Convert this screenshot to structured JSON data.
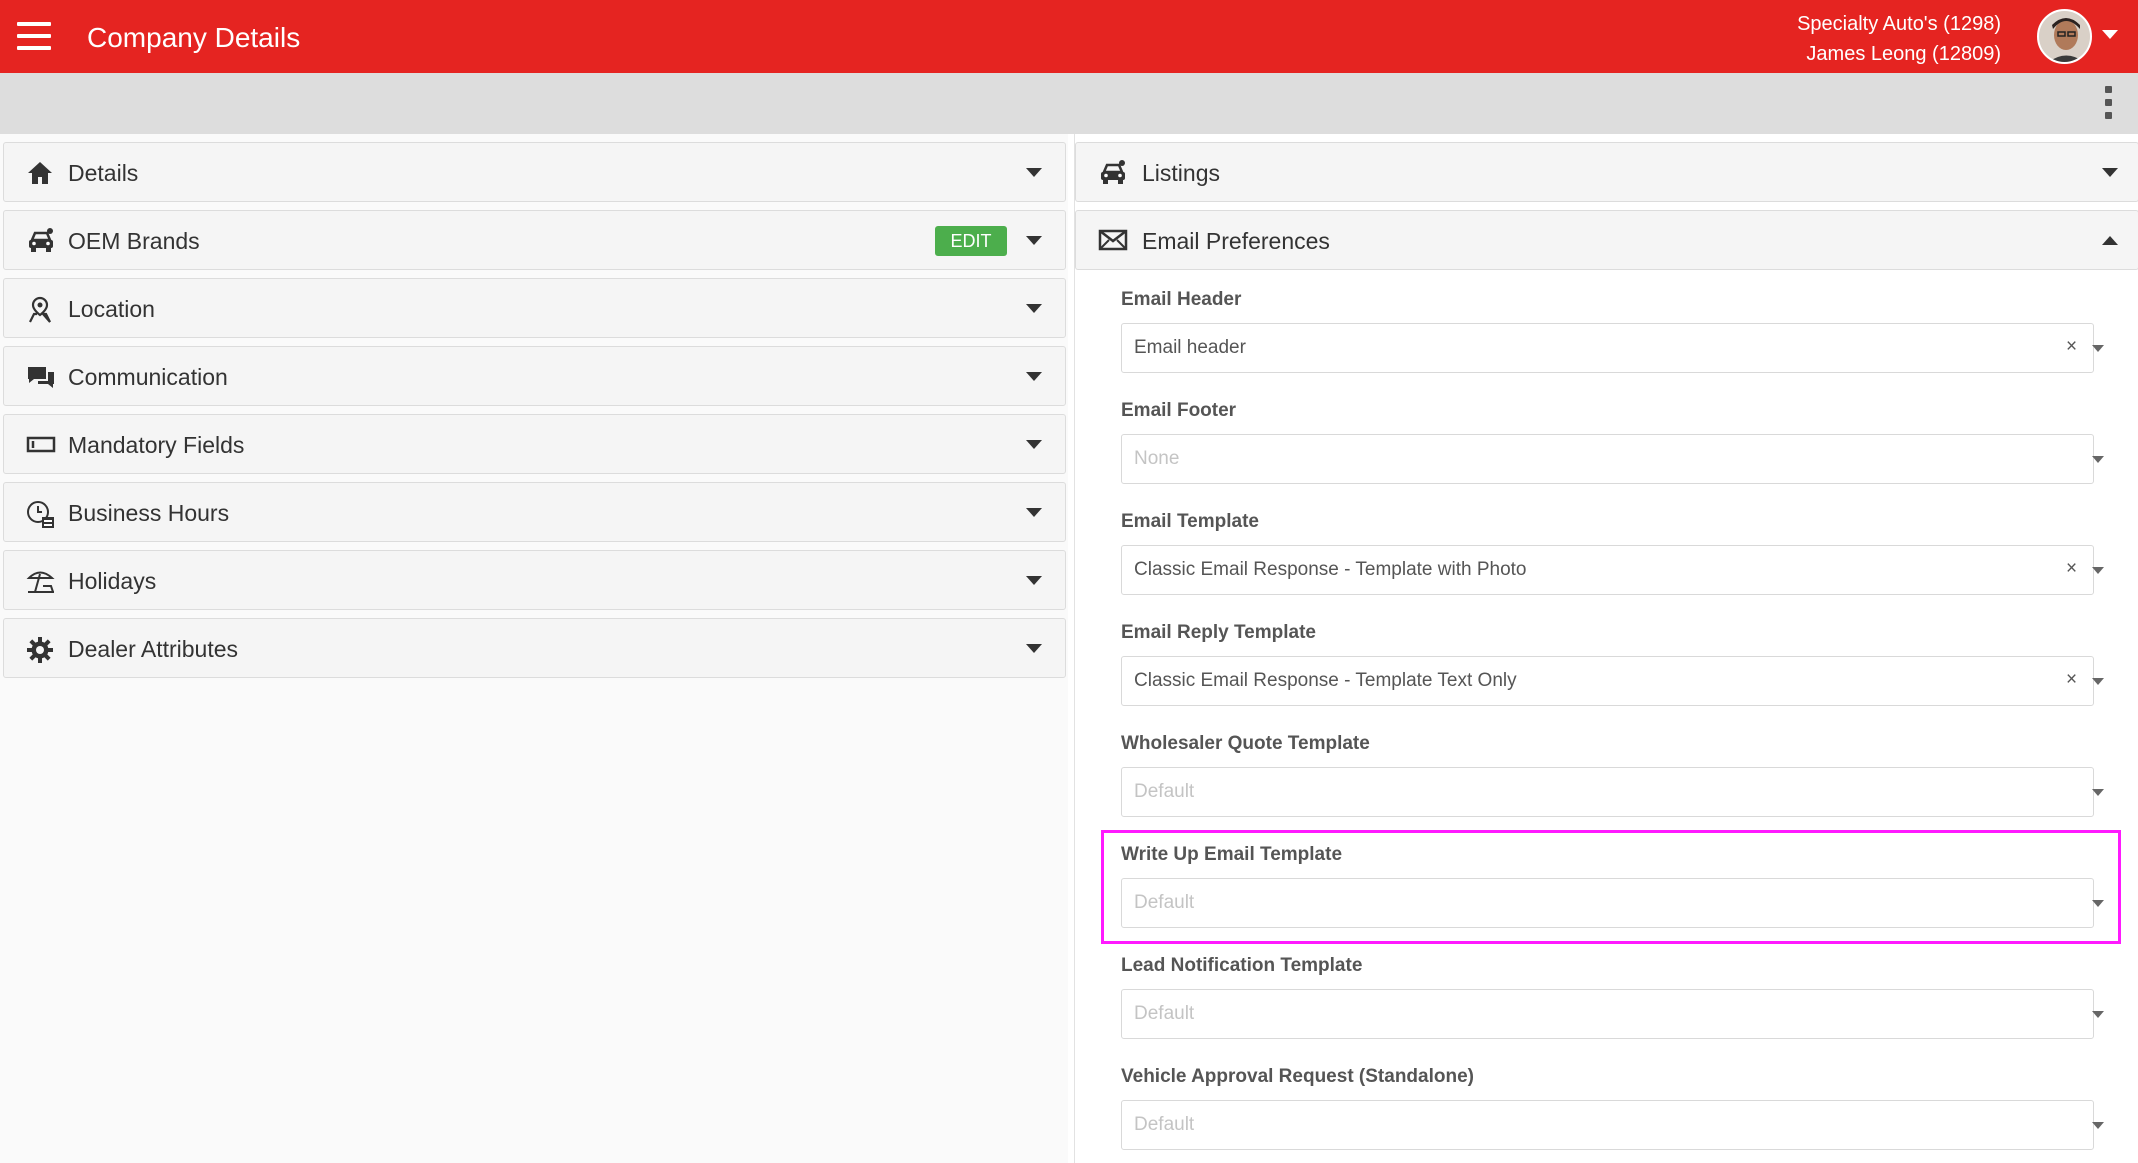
{
  "header": {
    "title": "Company Details",
    "dealer": "Specialty Auto's (1298)",
    "user": "James Leong (12809)"
  },
  "left_panels": [
    {
      "label": "Details",
      "icon": "home-icon"
    },
    {
      "label": "OEM Brands",
      "icon": "car-icon",
      "badge": "EDIT"
    },
    {
      "label": "Location",
      "icon": "location-pin-icon"
    },
    {
      "label": "Communication",
      "icon": "chat-bubbles-icon"
    },
    {
      "label": "Mandatory Fields",
      "icon": "input-field-icon"
    },
    {
      "label": "Business Hours",
      "icon": "clock-icon"
    },
    {
      "label": "Holidays",
      "icon": "beach-umbrella-icon"
    },
    {
      "label": "Dealer Attributes",
      "icon": "gear-icon"
    }
  ],
  "right_panels": {
    "listings": {
      "label": "Listings",
      "icon": "car-icon"
    },
    "email_preferences": {
      "label": "Email Preferences",
      "icon": "envelope-icon",
      "fields": [
        {
          "label": "Email Header",
          "value": "Email header",
          "placeholder": false,
          "clearable": true
        },
        {
          "label": "Email Footer",
          "value": "None",
          "placeholder": true,
          "clearable": false
        },
        {
          "label": "Email Template",
          "value": "Classic Email Response - Template with Photo",
          "placeholder": false,
          "clearable": true
        },
        {
          "label": "Email Reply Template",
          "value": "Classic Email Response - Template Text Only",
          "placeholder": false,
          "clearable": true
        },
        {
          "label": "Wholesaler Quote Template",
          "value": "Default",
          "placeholder": true,
          "clearable": false
        },
        {
          "label": "Write Up Email Template",
          "value": "Default",
          "placeholder": true,
          "clearable": false
        },
        {
          "label": "Lead Notification Template",
          "value": "Default",
          "placeholder": true,
          "clearable": false
        },
        {
          "label": "Vehicle Approval Request (Standalone)",
          "value": "Default",
          "placeholder": true,
          "clearable": false
        }
      ],
      "clear_symbol": "×"
    }
  },
  "colors": {
    "brand_red": "#e52421",
    "edit_green": "#4cae4c",
    "highlight_magenta": "#ff19ff"
  }
}
